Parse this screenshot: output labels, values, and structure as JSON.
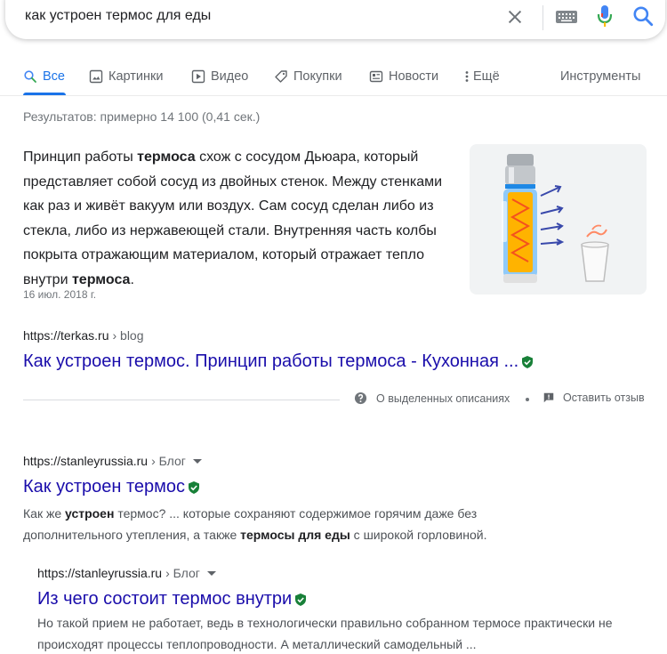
{
  "search": {
    "query": "как устроен термос для еды"
  },
  "tabs": [
    {
      "label": "Все",
      "icon": "search-icon",
      "active": true
    },
    {
      "label": "Картинки",
      "icon": "image-icon"
    },
    {
      "label": "Видео",
      "icon": "video-icon"
    },
    {
      "label": "Покупки",
      "icon": "tag-icon"
    },
    {
      "label": "Новости",
      "icon": "news-icon"
    },
    {
      "label": "Ещё",
      "icon": "more-vert-icon"
    }
  ],
  "tools_label": "Инструменты",
  "stats": "Результатов: примерно 14 100 (0,41 сек.)",
  "featured_snippet": {
    "text_parts": [
      "Принцип работы ",
      "термоса",
      " схож с сосудом Дьюара, который представляет собой сосуд из двойных стенок. Между стенками как раз и живёт вакуум или воздух. Сам сосуд сделан либо из стекла, либо из нержавеющей стали. Внутренняя часть колбы покрыта отражающим материалом, который отражает тепло внутри ",
      "термоса",
      "."
    ],
    "date": "16 июл. 2018 г.",
    "url": "https://terkas.ru",
    "url_path": "› blog",
    "title": "Как устроен термос. Принцип работы термоса - Кухонная ...",
    "about_label": "О выделенных описаниях",
    "feedback_label": "Оставить отзыв"
  },
  "results": [
    {
      "url": "https://stanleyrussia.ru",
      "url_path": "› Блог",
      "title": "Как устроен термос",
      "desc_parts": [
        "Как же ",
        "устроен",
        " термос? ... которые сохраняют содержимое горячим даже без дополнительного утепления, а также ",
        "термосы для еды",
        " с широкой горловиной."
      ]
    },
    {
      "url": "https://stanleyrussia.ru",
      "url_path": "› Блог",
      "title": "Из чего состоит термос внутри",
      "desc": "Но такой прием не работает, ведь в технологически правильно собранном термосе практически не происходят процессы теплопроводности. А металлический самодельный ..."
    }
  ],
  "colors": {
    "link": "#1a0dab",
    "accent": "#1a73e8",
    "verified": "#188038"
  }
}
